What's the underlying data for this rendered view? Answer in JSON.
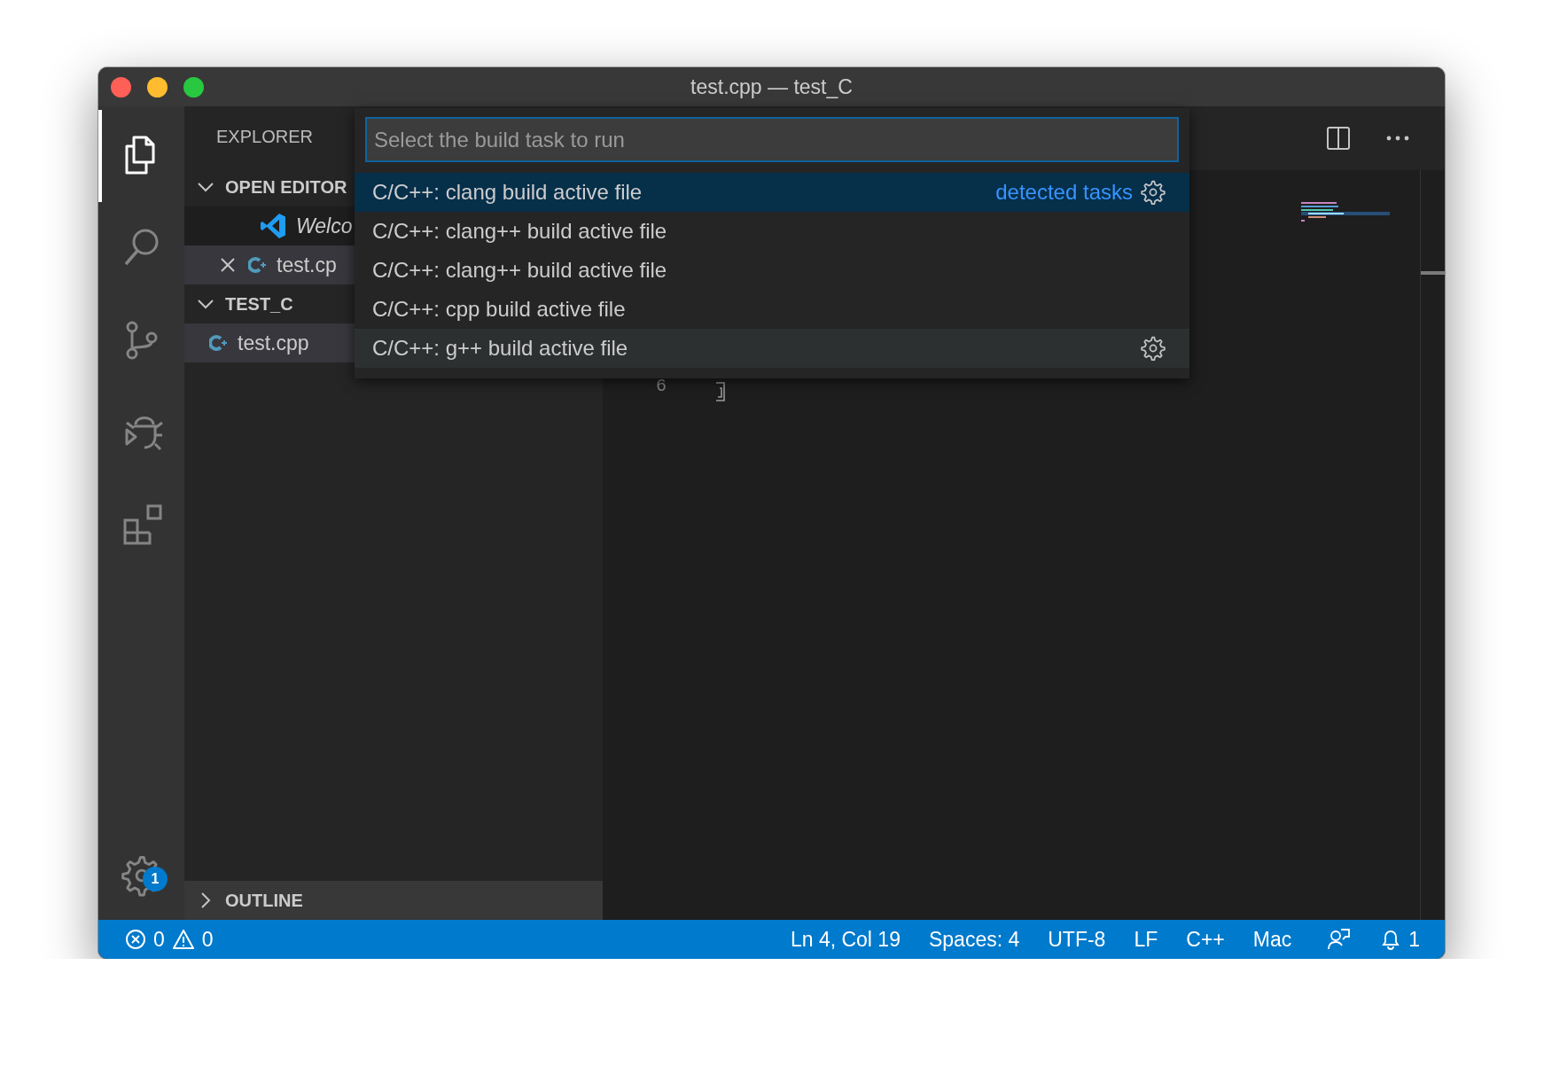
{
  "window": {
    "title": "test.cpp — test_C"
  },
  "activity_bar": {
    "items": [
      {
        "kind": "files",
        "selected": true
      },
      {
        "kind": "search",
        "selected": false
      },
      {
        "kind": "source-control",
        "selected": false
      },
      {
        "kind": "debug",
        "selected": false
      },
      {
        "kind": "extensions",
        "selected": false
      }
    ],
    "manage_badge": "1"
  },
  "sidebar": {
    "title": "EXPLORER",
    "sections": [
      {
        "title": "OPEN EDITOR",
        "expanded": true,
        "items": [
          {
            "label": "Welco",
            "kind": "welcome",
            "preview": true,
            "selected": false
          },
          {
            "label": "test.cp",
            "kind": "cpp",
            "preview": false,
            "selected": true
          }
        ]
      },
      {
        "title": "TEST_C",
        "expanded": true,
        "items": [
          {
            "label": "test.cpp",
            "kind": "cpp",
            "preview": false,
            "selected": true
          }
        ]
      }
    ],
    "outline": {
      "title": "OUTLINE",
      "expanded": false
    }
  },
  "editor": {
    "line_number": "6"
  },
  "quick_pick": {
    "placeholder": "Select the build task to run",
    "items": [
      {
        "label": "C/C++: clang build active file",
        "detail": "detected tasks",
        "selected": true,
        "hovered": false
      },
      {
        "label": "C/C++: clang++ build active file",
        "selected": false,
        "hovered": false
      },
      {
        "label": "C/C++: clang++ build active file",
        "selected": false,
        "hovered": false
      },
      {
        "label": "C/C++: cpp build active file",
        "selected": false,
        "hovered": false
      },
      {
        "label": "C/C++: g++ build active file",
        "selected": false,
        "hovered": true
      }
    ]
  },
  "status_bar": {
    "errors": "0",
    "warnings": "0",
    "items": [
      "Ln 4, Col 19",
      "Spaces: 4",
      "UTF-8",
      "LF",
      "C++",
      "Mac"
    ],
    "notifications": "1"
  }
}
